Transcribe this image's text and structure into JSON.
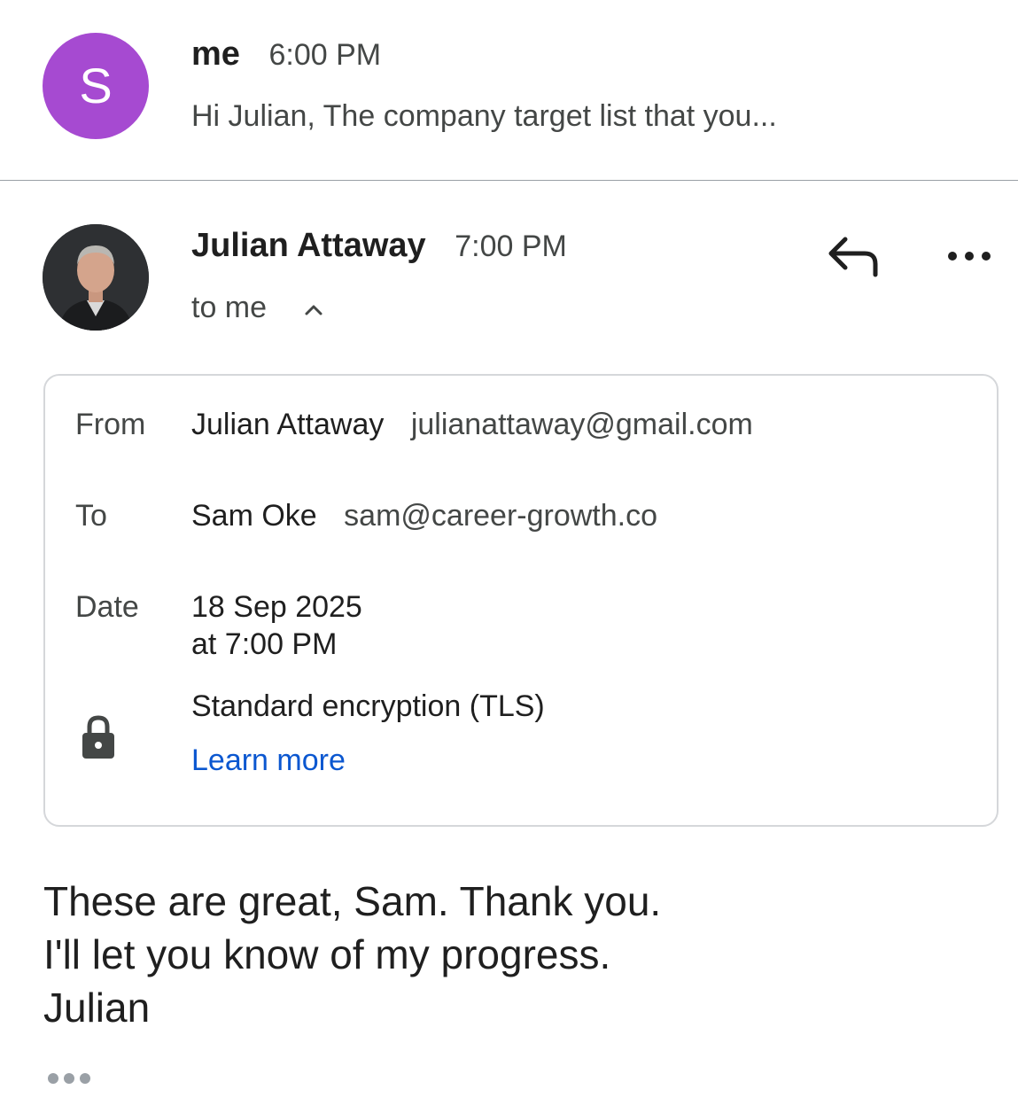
{
  "thread": {
    "previous_message": {
      "avatar_letter": "S",
      "avatar_color": "#a64ad1",
      "sender": "me",
      "time": "6:00 PM",
      "snippet": "Hi Julian, The company target list that you..."
    },
    "current_message": {
      "sender": "Julian Attaway",
      "time": "7:00 PM",
      "recipient_summary": "to me",
      "details": {
        "from_label": "From",
        "from_name": "Julian Attaway",
        "from_email": "julianattaway@gmail.com",
        "to_label": "To",
        "to_name": "Sam Oke",
        "to_email": "sam@career-growth.co",
        "date_label": "Date",
        "date_line1": "18 Sep 2025",
        "date_line2": "at 7:00 PM",
        "encryption": "Standard encryption (TLS)",
        "learn_more": "Learn more"
      },
      "body": [
        "These are great, Sam. Thank you.",
        "I'll let you know of my progress.",
        "Julian"
      ]
    }
  },
  "icons": {
    "reply": "reply-icon",
    "more": "more-options-icon",
    "collapse": "chevron-up-icon",
    "lock": "lock-icon",
    "trimmed": "show-trimmed-content-icon"
  },
  "colors": {
    "link": "#0b57d0",
    "avatar_s": "#a64ad1"
  }
}
